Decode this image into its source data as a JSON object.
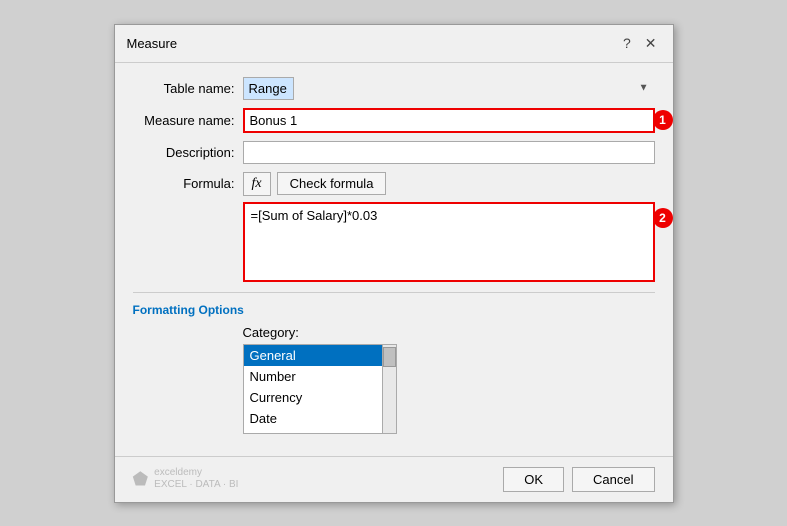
{
  "dialog": {
    "title": "Measure",
    "help_icon": "?",
    "close_icon": "✕"
  },
  "form": {
    "table_name_label": "Table name:",
    "table_name_value": "Range",
    "measure_name_label": "Measure name:",
    "measure_name_value": "Bonus 1",
    "measure_name_badge": "1",
    "description_label": "Description:",
    "description_value": "",
    "description_placeholder": "",
    "formula_label": "Formula:",
    "fx_label": "fx",
    "check_formula_label": "Check formula",
    "formula_value": "=[Sum of Salary]*0.03",
    "formula_badge": "2"
  },
  "formatting": {
    "section_title": "Formatting Options",
    "category_label": "Category:",
    "categories": [
      {
        "label": "General",
        "selected": true
      },
      {
        "label": "Number",
        "selected": false
      },
      {
        "label": "Currency",
        "selected": false
      },
      {
        "label": "Date",
        "selected": false
      }
    ]
  },
  "footer": {
    "watermark_line1": "exceldemy",
    "watermark_line2": "EXCEL · DATA · BI",
    "ok_label": "OK",
    "cancel_label": "Cancel"
  }
}
